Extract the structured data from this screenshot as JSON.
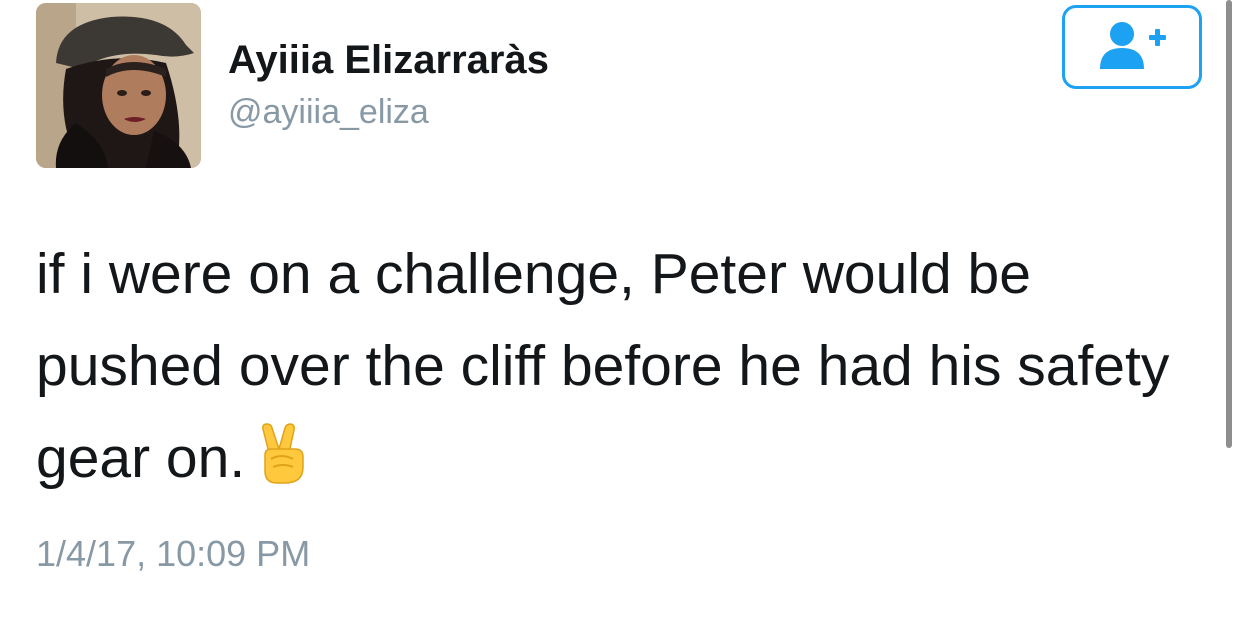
{
  "profile": {
    "display_name": "Ayiiia Elizarraràs",
    "handle": "@ayiiia_eliza"
  },
  "follow_button": {
    "icon": "add-user-icon"
  },
  "tweet": {
    "text": "if i were on a challenge, Peter would be pushed over the cliff before he had his safety gear on.",
    "emoji": "victory-hand-emoji",
    "timestamp": "1/4/17, 10:09 PM"
  },
  "colors": {
    "accent": "#1da1f2",
    "secondary_text": "#8899a6",
    "primary_text": "#14171a"
  }
}
